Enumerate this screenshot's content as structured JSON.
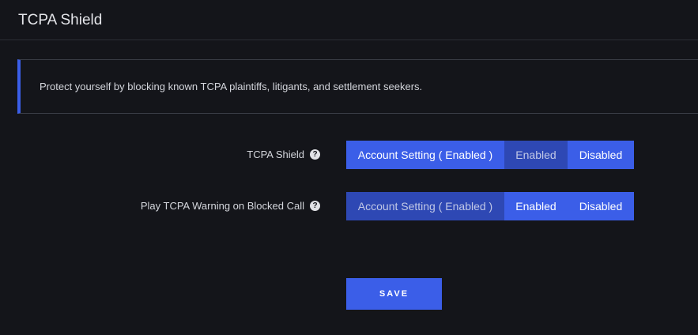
{
  "header": {
    "title": "TCPA Shield"
  },
  "banner": {
    "text": "Protect yourself by blocking known TCPA plaintiffs, litigants, and settlement seekers."
  },
  "settings": [
    {
      "label": "TCPA Shield",
      "help_icon": "question-circle-icon",
      "help_glyph": "?",
      "options": {
        "account": "Account Setting ( Enabled )",
        "enabled": "Enabled",
        "disabled": "Disabled"
      },
      "selected": "enabled"
    },
    {
      "label": "Play TCPA Warning on Blocked Call",
      "help_icon": "question-circle-icon",
      "help_glyph": "?",
      "options": {
        "account": "Account Setting ( Enabled )",
        "enabled": "Enabled",
        "disabled": "Disabled"
      },
      "selected": "account"
    }
  ],
  "actions": {
    "save_label": "SAVE"
  },
  "colors": {
    "background": "#14151a",
    "accent": "#3b5ee8",
    "selected_segment": "#2e48b4",
    "banner_border": "#3b5ee8"
  }
}
